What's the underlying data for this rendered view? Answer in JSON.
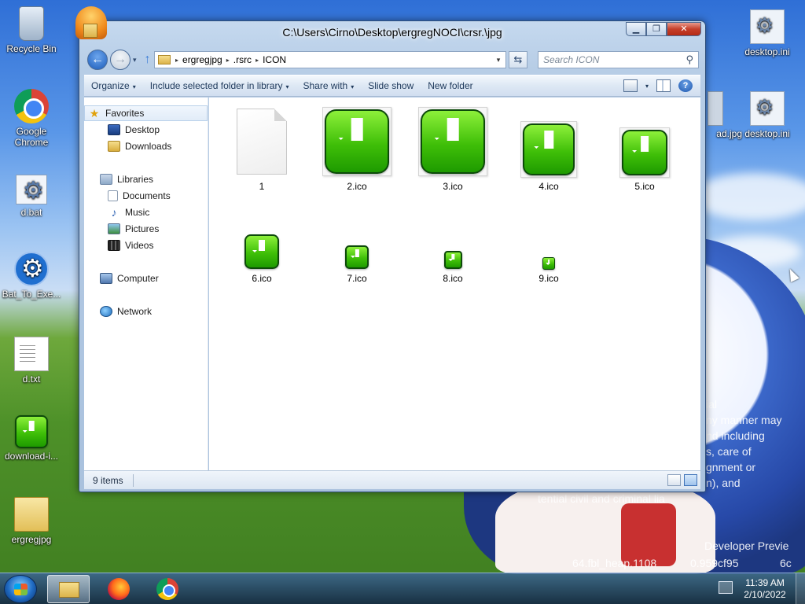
{
  "desktop": {
    "icons": [
      {
        "label": "Recycle Bin",
        "icon": "recycle-bin-icon"
      },
      {
        "label": "Google Chrome",
        "icon": "chrome-icon"
      },
      {
        "label": "d.bat",
        "icon": "batch-file-icon"
      },
      {
        "label": "Bat_To_Exe...",
        "icon": "gear-icon"
      },
      {
        "label": "d.txt",
        "icon": "text-file-icon"
      },
      {
        "label": "download-i...",
        "icon": "green-download-icon"
      },
      {
        "label": "ergregjpg",
        "icon": "folder-icon"
      }
    ],
    "right_icons": [
      {
        "label": "desktop.ini",
        "icon": "settings-file-icon"
      },
      {
        "label": "desktop.ini",
        "icon": "settings-file-icon"
      },
      {
        "label": "ad.jpg",
        "icon": "image-file-icon"
      }
    ],
    "wallpaper_text": {
      "lines": [
        "ial",
        "ny manner may",
        "nd including",
        "s, care of",
        "gnment or",
        "n), and",
        "tential civil and criminal lia"
      ],
      "developer": "Developer Previe",
      "build": "64.fbl_heap.1108",
      "hash": "0.959cf95",
      "tail": "6c"
    }
  },
  "window": {
    "title": "C:\\Users\\Cirno\\Desktop\\ergregNOCI\\crsr.\\jpg",
    "controls": {
      "minimize": "▁",
      "maximize": "❐",
      "close": "✕"
    },
    "address": {
      "segments": [
        "ergregjpg",
        ".rsrc",
        "ICON"
      ],
      "separator": "▸"
    },
    "refresh": "⇆",
    "search_placeholder": "Search ICON",
    "search_glyph": "⚲",
    "toolbar": {
      "organize": "Organize",
      "include": "Include selected folder in library",
      "share": "Share with",
      "slideshow": "Slide show",
      "newfolder": "New folder",
      "caret": "▾",
      "help": "?"
    },
    "nav_pane": {
      "favorites": "Favorites",
      "desktop": "Desktop",
      "downloads": "Downloads",
      "libraries": "Libraries",
      "documents": "Documents",
      "music": "Music",
      "pictures": "Pictures",
      "videos": "Videos",
      "computer": "Computer",
      "network": "Network",
      "star_glyph": "★",
      "music_glyph": "♪"
    },
    "files": [
      "1",
      "2.ico",
      "3.ico",
      "4.ico",
      "5.ico",
      "6.ico",
      "7.ico",
      "8.ico",
      "9.ico"
    ],
    "status": {
      "count": "9 items"
    }
  },
  "taskbar": {
    "clock_time": "11:39 AM",
    "clock_date": "2/10/2022"
  },
  "colors": {
    "accent_green": "#3fbf08",
    "window_chrome": "#b7cde6",
    "close_red": "#c63f2a"
  }
}
